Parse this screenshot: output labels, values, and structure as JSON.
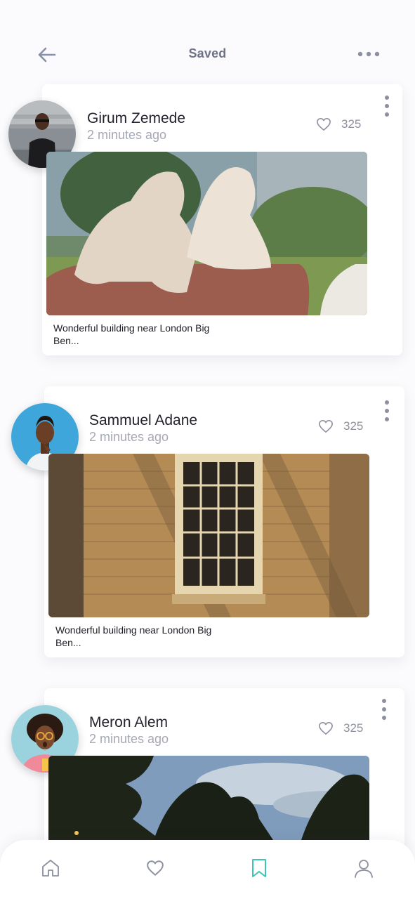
{
  "header": {
    "title": "Saved",
    "back_icon": "arrow-left-icon",
    "more_icon": "more-horizontal-icon"
  },
  "posts": [
    {
      "author": "Girum Zemede",
      "time": "2 minutes ago",
      "likes": "325",
      "caption": "Wonderful building near London Big Ben...",
      "photo": "two-white-lions-on-rock-photo"
    },
    {
      "author": "Sammuel Adane",
      "time": "2 minutes ago",
      "likes": "325",
      "caption": "Wonderful building near London Big Ben...",
      "photo": "stone-building-window-photo"
    },
    {
      "author": "Meron Alem",
      "time": "2 minutes ago",
      "likes": "325",
      "caption": "",
      "photo": "trees-against-sky-photo"
    }
  ],
  "bottom_nav": {
    "items": [
      "home-icon",
      "heart-icon",
      "bookmark-icon",
      "profile-icon"
    ],
    "active": "bookmark-icon"
  },
  "colors": {
    "accent": "#3ac7b4",
    "muted_icon": "#8d90a0",
    "title": "#6e7388"
  }
}
